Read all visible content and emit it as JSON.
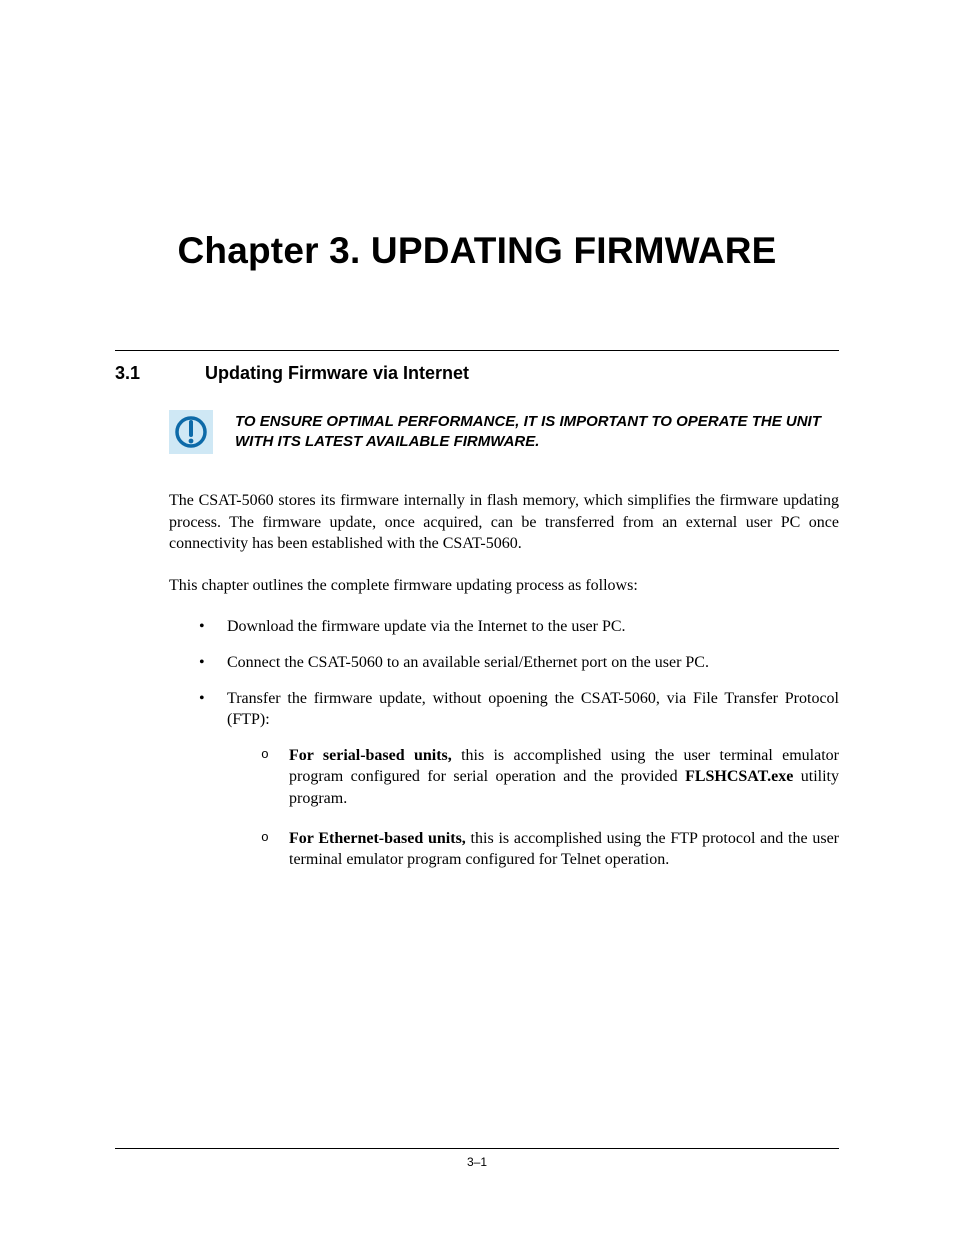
{
  "chapter": {
    "title": "Chapter 3. UPDATING FIRMWARE"
  },
  "section": {
    "number": "3.1",
    "title": "Updating Firmware via Internet"
  },
  "callout": {
    "text": "TO ENSURE OPTIMAL PERFORMANCE, IT IS IMPORTANT TO OPERATE THE UNIT WITH ITS LATEST AVAILABLE FIRMWARE."
  },
  "paragraphs": {
    "p1": "The CSAT-5060 stores its firmware internally in flash memory, which simplifies the firmware updating process. The firmware update, once acquired, can be transferred from an external user PC once connectivity has been established with the CSAT-5060.",
    "p2": "This chapter outlines the complete firmware updating process as follows:"
  },
  "bullets": {
    "b1": "Download the firmware update via the Internet to the user PC.",
    "b2": "Connect the CSAT-5060 to an available serial/Ethernet port on the user PC.",
    "b3": "Transfer the firmware update, without opoening the CSAT-5060, via File Transfer Protocol (FTP):",
    "sub1": {
      "lead": "For serial-based units,",
      "rest": " this is accomplished using the user terminal emulator program configured for serial operation and the provided ",
      "prog": "FLSHCSAT.exe",
      "tail": " utility program."
    },
    "sub2": {
      "lead": "For Ethernet-based units,",
      "rest": " this is accomplished using the FTP protocol and the user terminal emulator program configured for Telnet operation."
    }
  },
  "footer": {
    "page": "3–1"
  }
}
